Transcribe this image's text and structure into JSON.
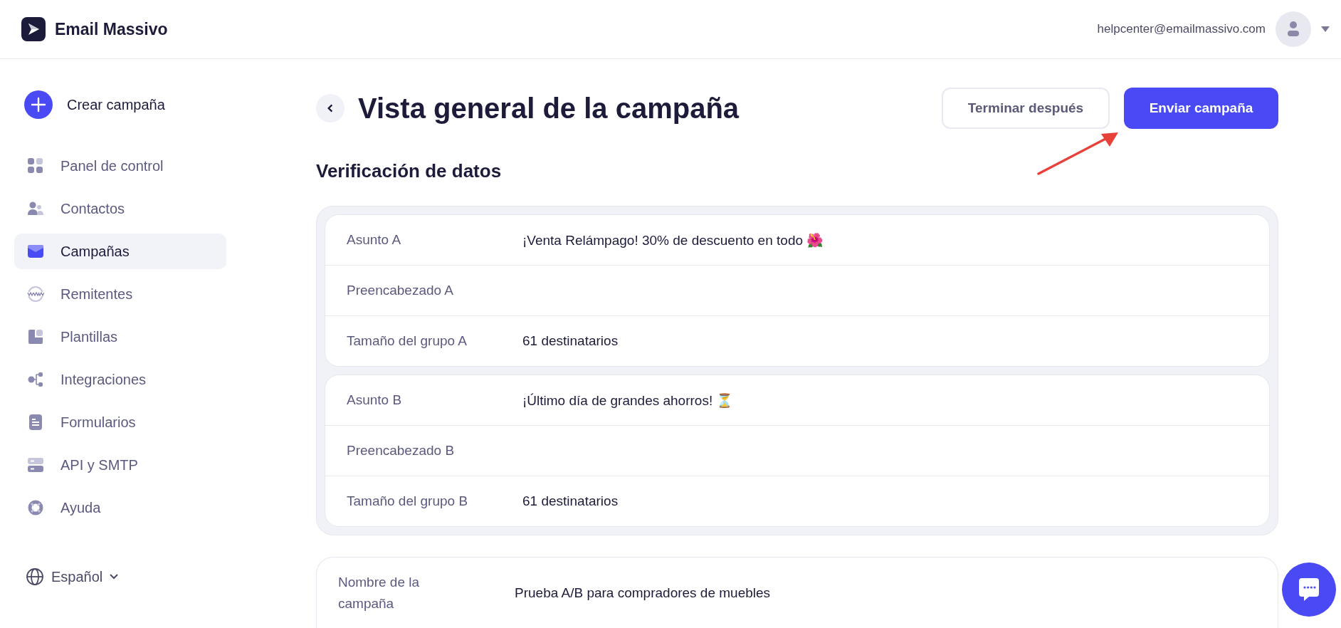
{
  "header": {
    "brand": "Email Massivo",
    "user_email": "helpcenter@emailmassivo.com"
  },
  "sidebar": {
    "create_button": "Crear campaña",
    "items": [
      {
        "label": "Panel de control",
        "selected": false
      },
      {
        "label": "Contactos",
        "selected": false
      },
      {
        "label": "Campañas",
        "selected": true
      },
      {
        "label": "Remitentes",
        "selected": false
      },
      {
        "label": "Plantillas",
        "selected": false
      },
      {
        "label": "Integraciones",
        "selected": false
      },
      {
        "label": "Formularios",
        "selected": false
      },
      {
        "label": "API y SMTP",
        "selected": false
      },
      {
        "label": "Ayuda",
        "selected": false
      }
    ],
    "language": "Español"
  },
  "page": {
    "title": "Vista general de la campaña",
    "buttons": [
      {
        "label": "Terminar después",
        "kind": "secondary"
      },
      {
        "label": "Enviar campaña",
        "kind": "primary"
      }
    ],
    "section_title": "Verificación de datos",
    "groups": [
      {
        "rows": [
          {
            "label": "Asunto A",
            "value": "¡Venta Relámpago! 30% de descuento en todo 🌺"
          },
          {
            "label": "Preencabezado A"
          },
          {
            "label": "Tamaño del grupo A",
            "value": "61 destinatarios"
          }
        ]
      },
      {
        "rows": [
          {
            "label": "Asunto B",
            "value": "¡Último día de grandes ahorros! ⏳"
          },
          {
            "label": "Preencabezado B"
          },
          {
            "label": "Tamaño del grupo B",
            "value": "61 destinatarios"
          }
        ]
      }
    ],
    "campaign_details": [
      {
        "label": "Nombre de la campaña",
        "value": "Prueba A/B para compradores de muebles"
      }
    ]
  }
}
